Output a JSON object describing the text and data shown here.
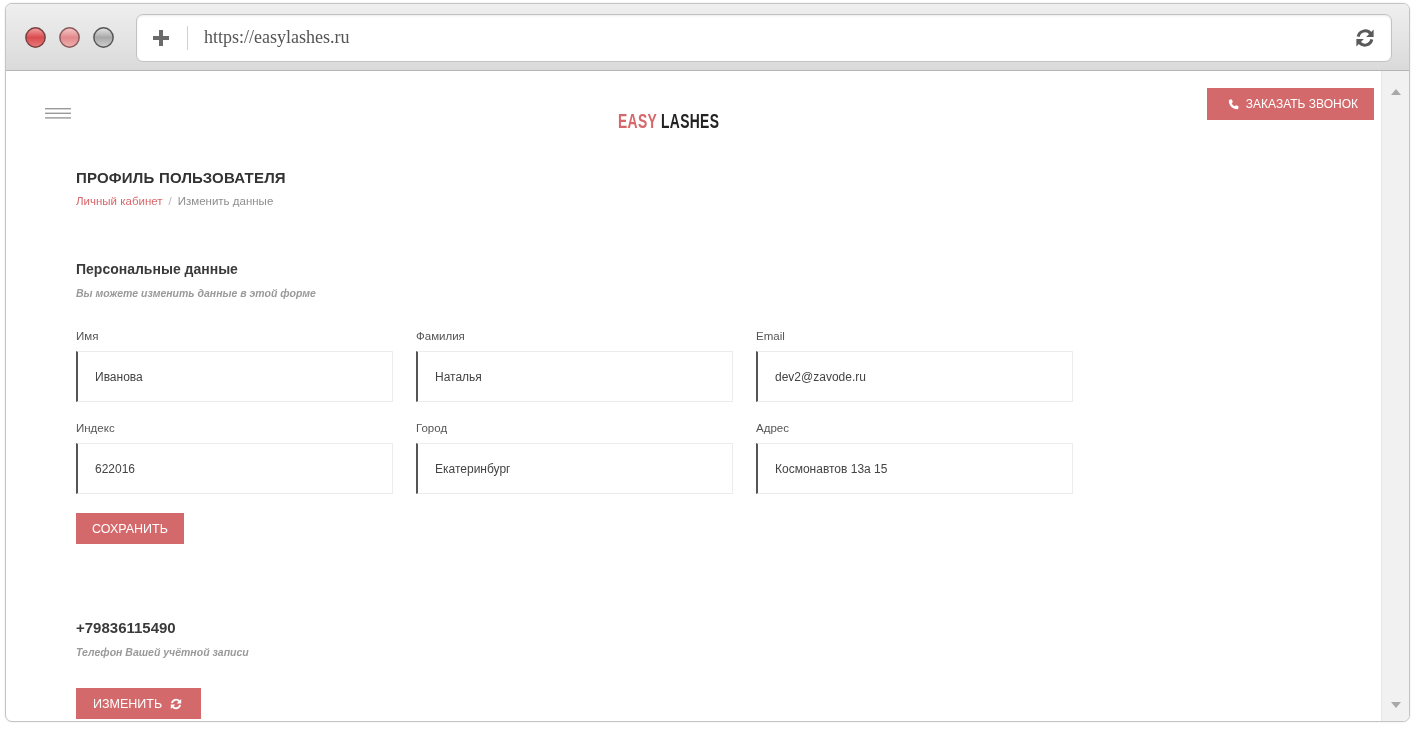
{
  "browser": {
    "url": "https://easylashes.ru"
  },
  "header": {
    "logo": {
      "accent": "EASY",
      "main": "LASHES"
    },
    "call_button": {
      "label": "ЗАКАЗАТЬ ЗВОНОК"
    }
  },
  "profile": {
    "title": "ПРОФИЛЬ ПОЛЬЗОВАТЕЛЯ",
    "breadcrumb": {
      "separator": "/",
      "items": [
        {
          "label": "Личный кабинет",
          "kind": "link"
        },
        {
          "label": "Изменить данные",
          "kind": "current"
        }
      ]
    }
  },
  "personal_data": {
    "heading": "Персональные данные",
    "hint": "Вы можете изменить данные в этой форме",
    "fields": [
      {
        "label": "Имя",
        "value": "Иванова"
      },
      {
        "label": "Фамилия",
        "value": "Наталья"
      },
      {
        "label": "Email",
        "value": "dev2@zavode.ru"
      },
      {
        "label": "Индекс",
        "value": "622016"
      },
      {
        "label": "Город",
        "value": "Екатеринбург"
      },
      {
        "label": "Адрес",
        "value": "Космонавтов 13а 15"
      }
    ],
    "save_button": {
      "label": "СОХРАНИТЬ"
    }
  },
  "account_phone": {
    "number": "+79836115490",
    "hint": "Телефон Вашей учётной записи",
    "change_button": {
      "label": "ИЗМЕНИТЬ"
    }
  }
}
